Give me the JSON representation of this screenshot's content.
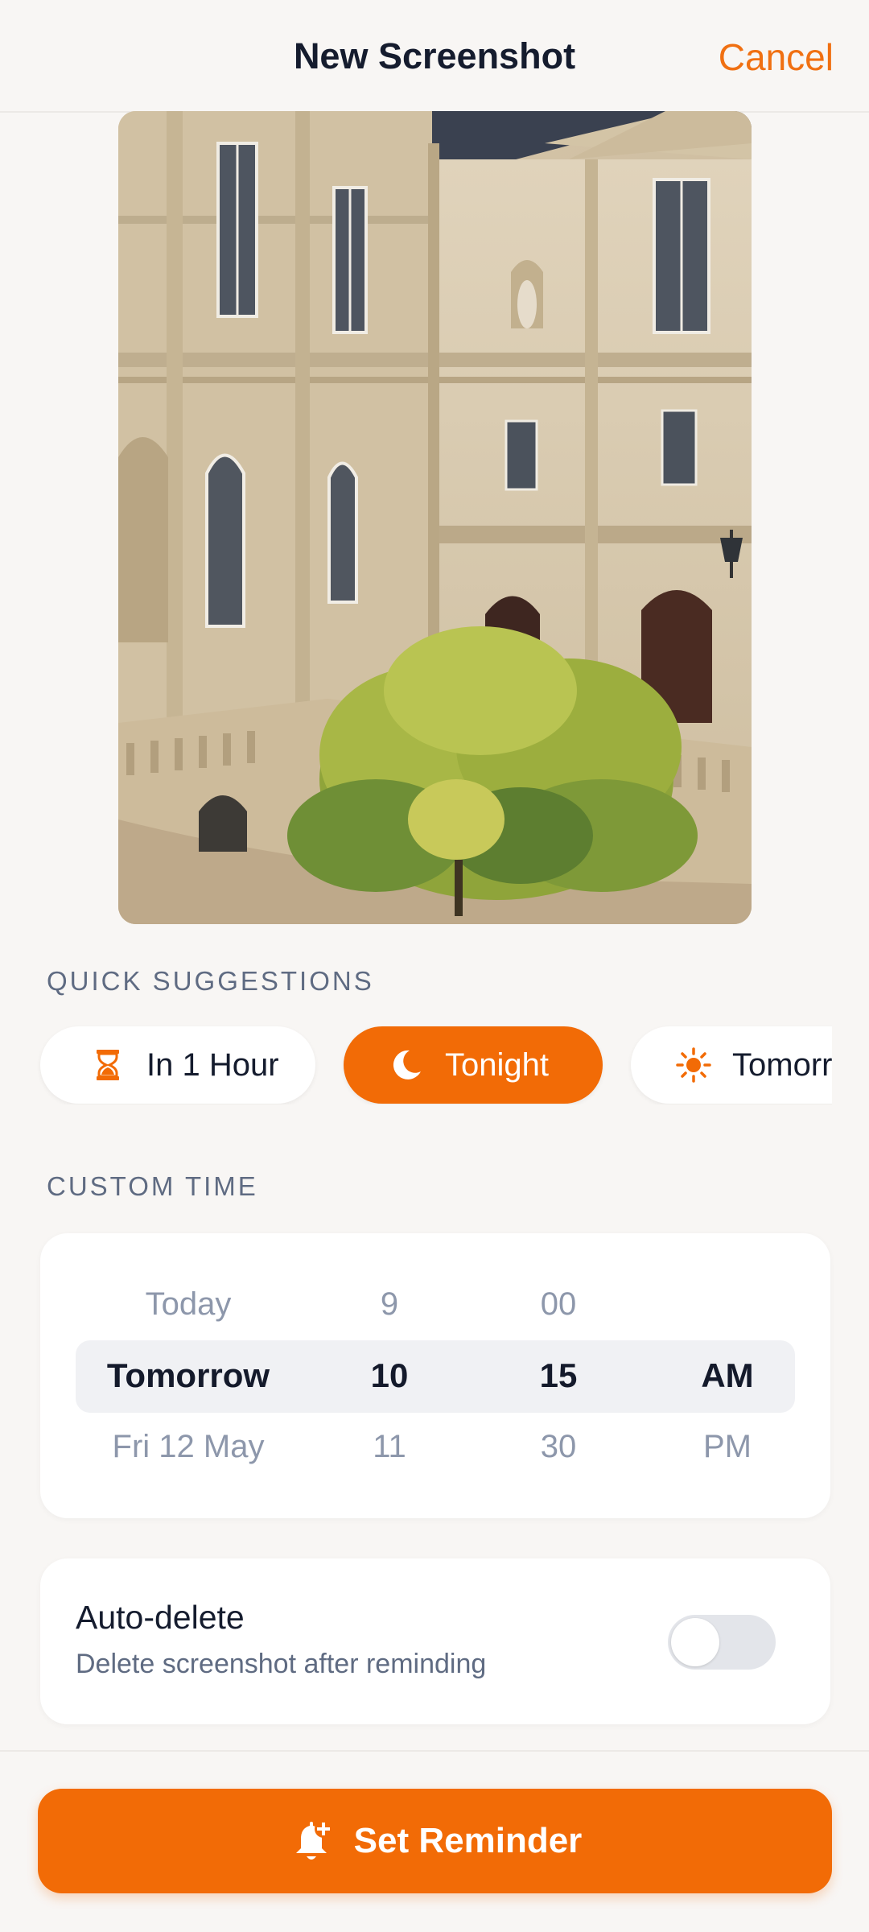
{
  "header": {
    "title": "New Screenshot",
    "cancel_label": "Cancel"
  },
  "preview": {
    "alt": "screenshot-preview-building-courtyard"
  },
  "quick_suggestions": {
    "label": "QUICK SUGGESTIONS",
    "chips": [
      {
        "label": "In 1 Hour",
        "icon": "hourglass-icon",
        "active": false
      },
      {
        "label": "Tonight",
        "icon": "moon-icon",
        "active": true
      },
      {
        "label": "Tomorrow",
        "icon": "sun-icon",
        "active": false
      }
    ]
  },
  "custom_time": {
    "label": "CUSTOM TIME",
    "day": [
      "Today",
      "Tomorrow",
      "Fri 12 May"
    ],
    "hour": [
      "9",
      "10",
      "11"
    ],
    "minute": [
      "00",
      "15",
      "30"
    ],
    "period": [
      "",
      "AM",
      "PM"
    ]
  },
  "auto_delete": {
    "title": "Auto-delete",
    "subtitle": "Delete screenshot after reminding",
    "enabled": false
  },
  "cta": {
    "label": "Set Reminder",
    "icon": "bell-plus-icon"
  },
  "colors": {
    "accent": "#f26b06",
    "background": "#f8f6f4",
    "muted_text": "#5f6b82"
  }
}
